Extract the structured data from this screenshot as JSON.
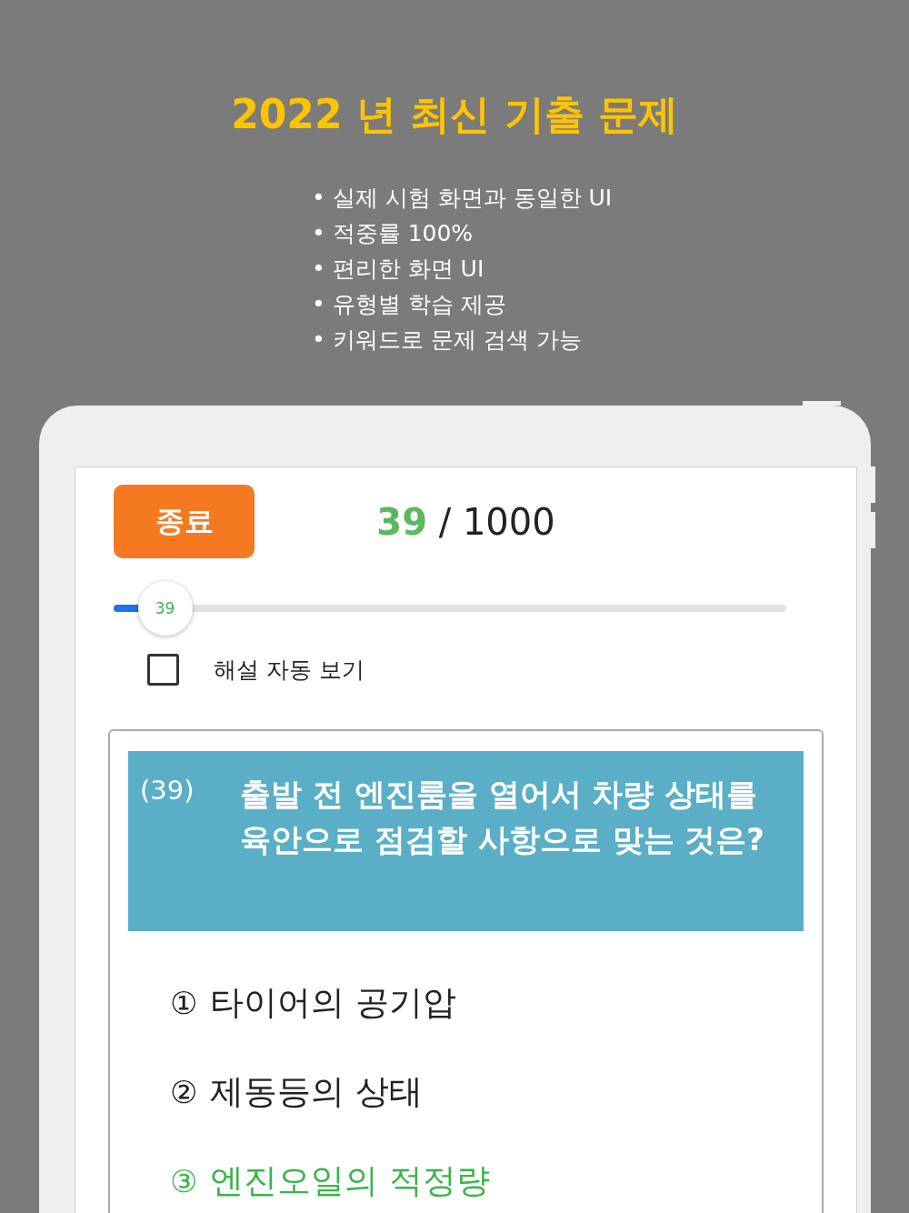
{
  "headline": "2022 년 최신 기출 문제",
  "features": [
    "• 실제 시험 화면과 동일한 UI",
    "• 적중률 100%",
    "• 편리한 화면 UI",
    "• 유형별 학습 제공",
    "• 키워드로 문제 검색 가능"
  ],
  "quiz": {
    "end_button": "종료",
    "current": "39",
    "total": "/ 1000",
    "slider": {
      "level": 0.039,
      "label": "39"
    },
    "auto_explain": {
      "label": "해설 자동 보기",
      "checked": false
    },
    "question": {
      "number": "(39)",
      "text": "출발 전 엔진룸을 열어서 차량 상태를 육안으로 점검할 사항으로 맞는 것은?"
    },
    "options": [
      {
        "mark": "①",
        "text": "타이어의 공기압",
        "correct": false
      },
      {
        "mark": "②",
        "text": "제동등의 상태",
        "correct": false
      },
      {
        "mark": "③",
        "text": "엔진오일의 적정량",
        "correct": true
      }
    ]
  }
}
